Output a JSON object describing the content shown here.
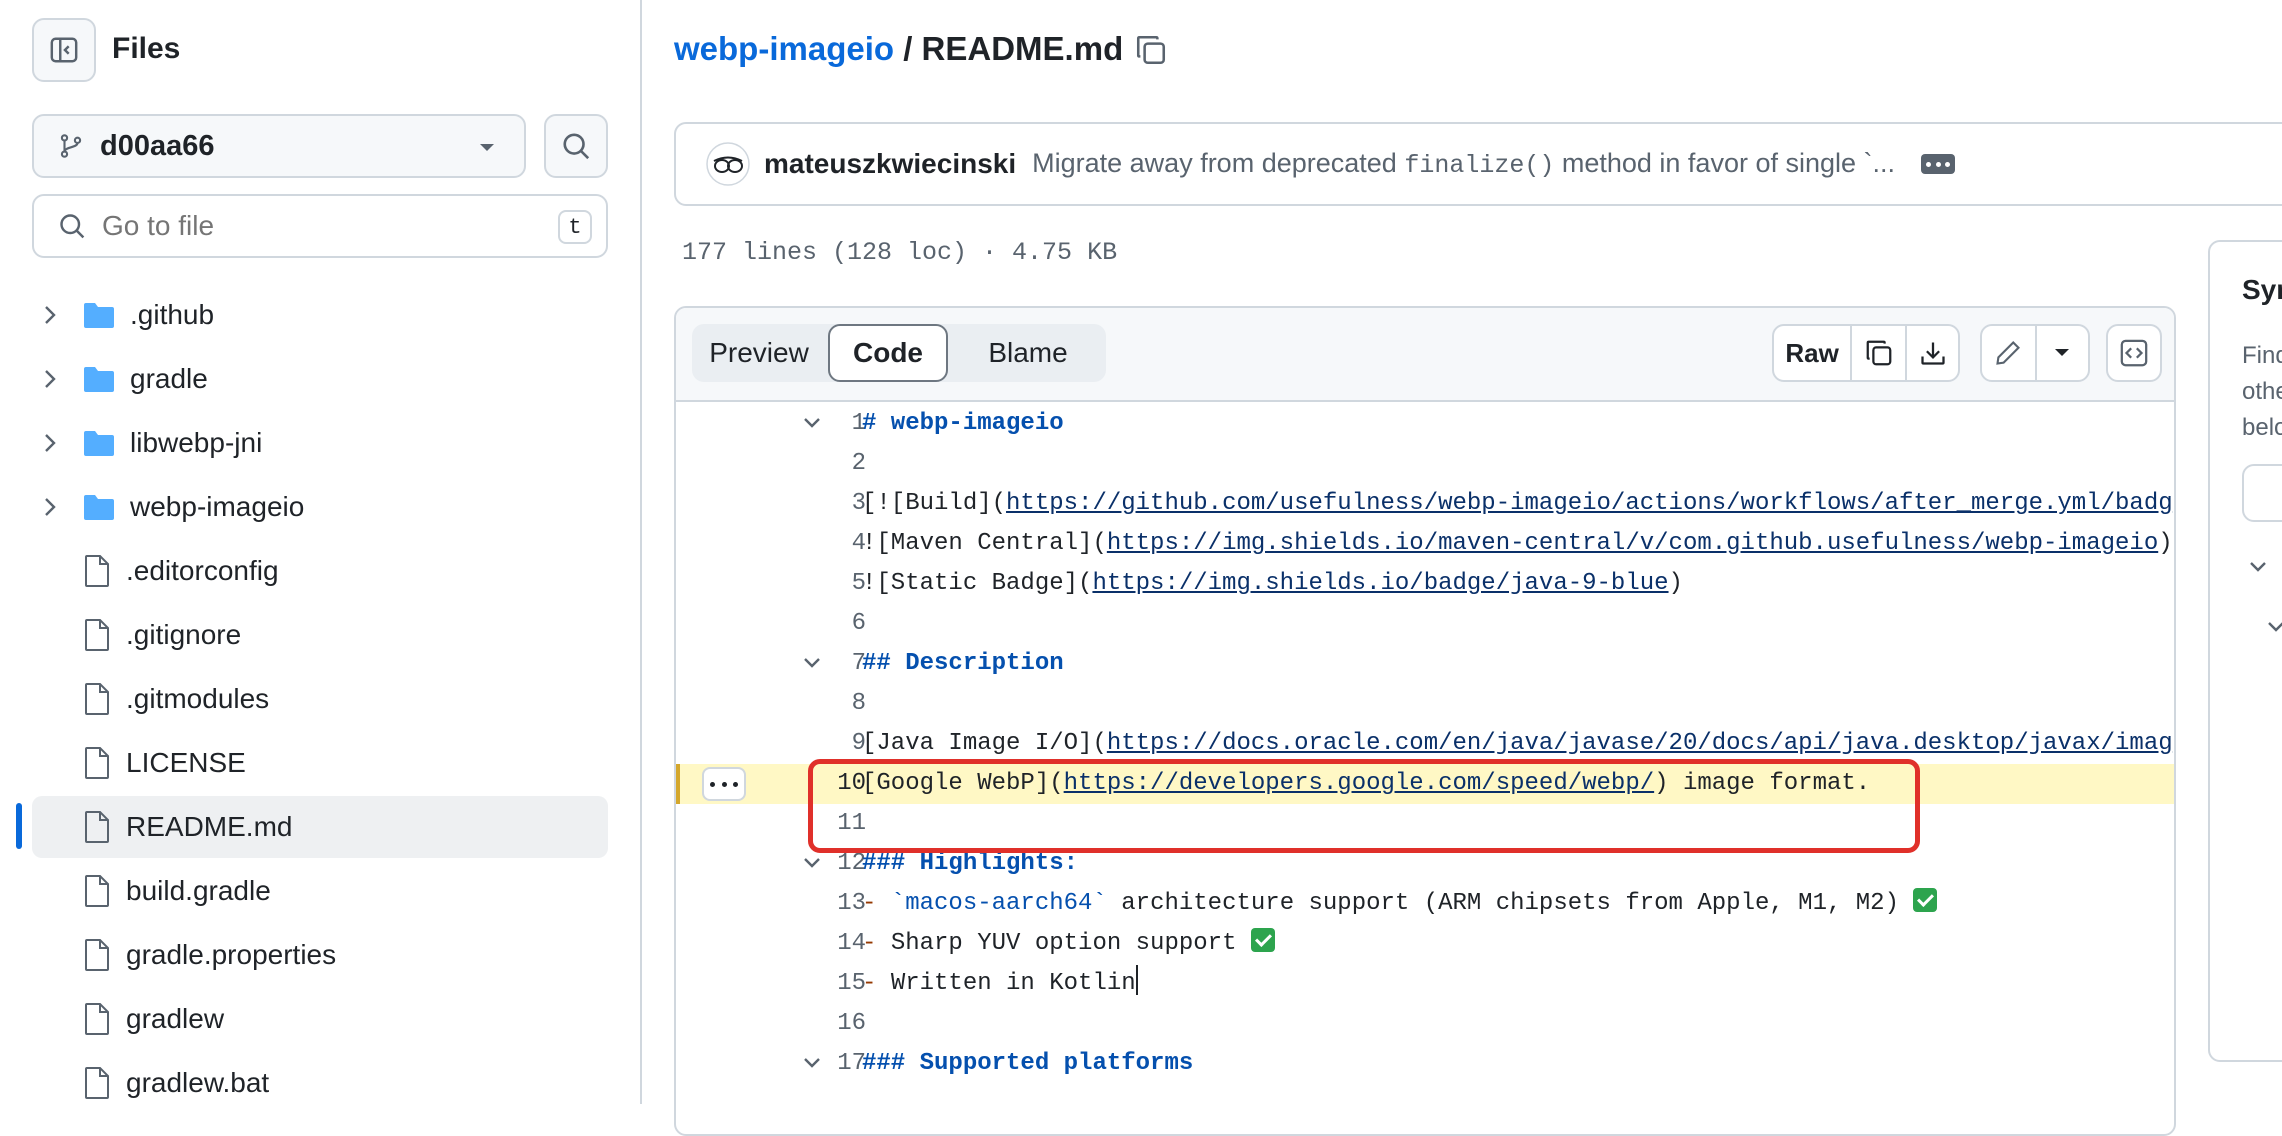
{
  "sidebar": {
    "title": "Files",
    "branch": "d00aa66",
    "search_placeholder": "Go to file",
    "search_shortcut": "t",
    "items": [
      {
        "type": "folder",
        "label": ".github"
      },
      {
        "type": "folder",
        "label": "gradle"
      },
      {
        "type": "folder",
        "label": "libwebp-jni"
      },
      {
        "type": "folder",
        "label": "webp-imageio"
      },
      {
        "type": "file",
        "label": ".editorconfig"
      },
      {
        "type": "file",
        "label": ".gitignore"
      },
      {
        "type": "file",
        "label": ".gitmodules"
      },
      {
        "type": "file",
        "label": "LICENSE"
      },
      {
        "type": "file",
        "label": "README.md",
        "selected": true
      },
      {
        "type": "file",
        "label": "build.gradle"
      },
      {
        "type": "file",
        "label": "gradle.properties"
      },
      {
        "type": "file",
        "label": "gradlew"
      },
      {
        "type": "file",
        "label": "gradlew.bat"
      }
    ]
  },
  "breadcrumb": {
    "repo": "webp-imageio",
    "separator": "/",
    "file": "README.md"
  },
  "commit": {
    "author": "mateuszkwiecinski",
    "message_prefix": "Migrate away from deprecated ",
    "message_code": "finalize()",
    "message_suffix": " method in favor of single `..."
  },
  "file_meta": "177 lines (128 loc) · 4.75 KB",
  "view_tabs": {
    "preview": "Preview",
    "code": "Code",
    "blame": "Blame",
    "active": "Code"
  },
  "toolbar": {
    "raw": "Raw"
  },
  "code": {
    "lines": [
      {
        "n": "1"
      },
      {
        "n": "2"
      },
      {
        "n": "3"
      },
      {
        "n": "4"
      },
      {
        "n": "5"
      },
      {
        "n": "6"
      },
      {
        "n": "7"
      },
      {
        "n": "8"
      },
      {
        "n": "9"
      },
      {
        "n": "10"
      },
      {
        "n": "11"
      },
      {
        "n": "12"
      },
      {
        "n": "13"
      },
      {
        "n": "14"
      },
      {
        "n": "15"
      },
      {
        "n": "16"
      },
      {
        "n": "17"
      }
    ],
    "l1": "# webp-imageio",
    "l3a": "[![Build](",
    "l3u": "https://github.com/usefulness/webp-imageio/actions/workflows/after_merge.yml/badg",
    "l4a": "![Maven Central](",
    "l4u": "https://img.shields.io/maven-central/v/com.github.usefulness/webp-imageio",
    "l4b": ")",
    "l5a": "![Static Badge](",
    "l5u": "https://img.shields.io/badge/java-9-blue",
    "l5b": ")",
    "l7": "## Description",
    "l9a": "[Java Image I/O](",
    "l9u": "https://docs.oracle.com/en/java/javase/20/docs/api/java.desktop/javax/imag",
    "l10a": "[Google WebP](",
    "l10u": "https://developers.google.com/speed/webp/",
    "l10b": ") image format.",
    "l12": "### Highlights:",
    "l13m": "- ",
    "l13c": "`macos-aarch64`",
    "l13t": " architecture support (ARM chipsets from Apple, M1, M2) ",
    "l14m": "- ",
    "l14t": "Sharp YUV option support ",
    "l15m": "- ",
    "l15t": "Written in Kotlin",
    "l17": "### Supported platforms"
  },
  "side_panel": {
    "title": "Sym",
    "text": "Find\nothe\nbelo"
  },
  "colors": {
    "accent": "#0969da",
    "highlight": "#fff8c5",
    "annotation": "#e0302a"
  }
}
